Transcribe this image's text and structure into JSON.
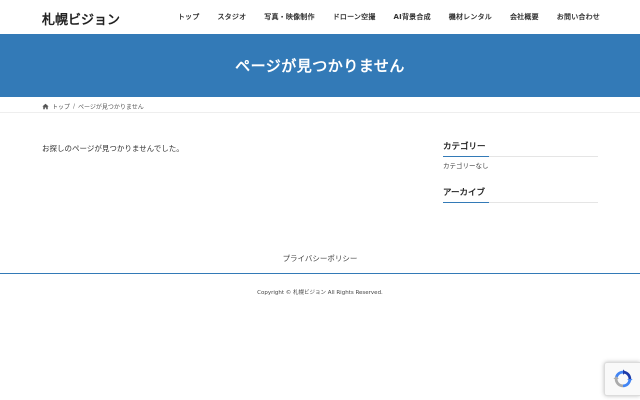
{
  "colors": {
    "accent": "#337ab7",
    "header_text": "#ffffff"
  },
  "header": {
    "logo": "札幌ビジョン",
    "nav": [
      {
        "label": "トップ"
      },
      {
        "label": "スタジオ"
      },
      {
        "label": "写真・映像制作"
      },
      {
        "label": "ドローン空撮"
      },
      {
        "label": "AI背景合成"
      },
      {
        "label": "機材レンタル"
      },
      {
        "label": "会社概要"
      },
      {
        "label": "お問い合わせ"
      }
    ]
  },
  "page_header": {
    "title": "ページが見つかりません"
  },
  "breadcrumb": {
    "home_icon": "home-icon",
    "home_label": "トップ",
    "separator": "/",
    "current": "ページが見つかりません"
  },
  "main": {
    "message": "お探しのページが見つかりませんでした。"
  },
  "sidebar": {
    "category_title": "カテゴリー",
    "category_empty": "カテゴリーなし",
    "archive_title": "アーカイブ"
  },
  "footer": {
    "menu_link": "プライバシーポリシー",
    "copyright": "Copyright © 札幌ビジョン All Rights Reserved."
  },
  "recaptcha": {
    "icon": "recaptcha-icon"
  }
}
